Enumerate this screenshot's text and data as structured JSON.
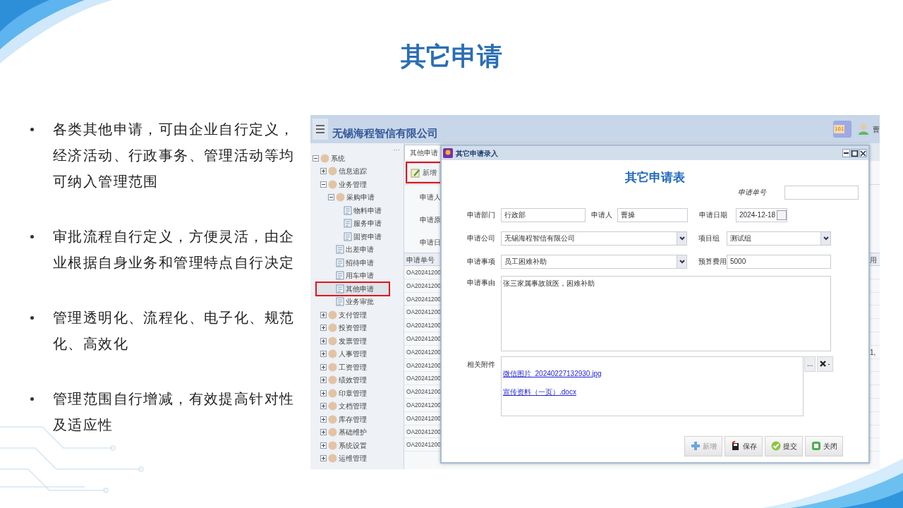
{
  "slide": {
    "title": "其它申请",
    "bullets": [
      "各类其他申请，可由企业自行定义，经济活动、行政事务、管理活动等均可纳入管理范围",
      "审批流程自行定义，方便灵活，由企业根据自身业务和管理特点自行决定",
      "管理透明化、流程化、电子化、规范化、高效化",
      "管理范围自行增减，有效提高针对性及适应性"
    ]
  },
  "app": {
    "company": "无锡海程智信有限公司",
    "notification_count": "161",
    "user": "曹",
    "sidebar": {
      "more": "···",
      "tree": [
        {
          "label": "系统",
          "expanded": true,
          "selected": false,
          "children": [
            {
              "label": "信息追踪",
              "expanded": false,
              "selected": false
            },
            {
              "label": "业务管理",
              "expanded": true,
              "selected": false,
              "children": [
                {
                  "label": "采购申请",
                  "expanded": true,
                  "selected": false,
                  "children": [
                    {
                      "label": "物料申请",
                      "selected": false
                    },
                    {
                      "label": "服务申请",
                      "selected": false
                    },
                    {
                      "label": "固资申请",
                      "selected": false
                    }
                  ]
                },
                {
                  "label": "出差申请",
                  "selected": false
                },
                {
                  "label": "招待申请",
                  "selected": false
                },
                {
                  "label": "用车申请",
                  "selected": false
                },
                {
                  "label": "其他申请",
                  "selected": true
                },
                {
                  "label": "业务审批",
                  "selected": false
                }
              ]
            },
            {
              "label": "支付管理",
              "expanded": false,
              "selected": false
            },
            {
              "label": "投资管理",
              "expanded": false,
              "selected": false
            },
            {
              "label": "发票管理",
              "expanded": false,
              "selected": false
            },
            {
              "label": "人事管理",
              "expanded": false,
              "selected": false
            },
            {
              "label": "工资管理",
              "expanded": false,
              "selected": false
            },
            {
              "label": "绩效管理",
              "expanded": false,
              "selected": false
            },
            {
              "label": "印章管理",
              "expanded": false,
              "selected": false
            },
            {
              "label": "文档管理",
              "expanded": false,
              "selected": false
            },
            {
              "label": "库存管理",
              "expanded": false,
              "selected": false
            },
            {
              "label": "基础维护",
              "expanded": false,
              "selected": false
            },
            {
              "label": "系统设置",
              "expanded": false,
              "selected": false
            },
            {
              "label": "运维管理",
              "expanded": false,
              "selected": false
            }
          ]
        }
      ]
    },
    "tab": {
      "label": "其他申请",
      "selected": true
    },
    "toolbar": [
      {
        "label": "新增",
        "highlighted": true
      }
    ],
    "filters": [
      "申请人",
      "申请原",
      "申请日"
    ],
    "grid": {
      "columns": [
        "申请单号",
        "用"
      ],
      "rows": [
        {
          "number": "OA20241200"
        },
        {
          "number": "OA20241200"
        },
        {
          "number": "OA20241200"
        },
        {
          "number": "OA20241200"
        },
        {
          "number": "OA20241200"
        },
        {
          "number": "OA20241200"
        },
        {
          "number": "OA20241200",
          "fee": "1,"
        },
        {
          "number": "OA20241200"
        },
        {
          "number": "OA20241200"
        },
        {
          "number": "OA20241200"
        },
        {
          "number": "OA20241200"
        },
        {
          "number": "OA20241200"
        },
        {
          "number": "OA20241200"
        },
        {
          "number": "OA20241200"
        }
      ]
    },
    "dialog": {
      "title": "其它申请录入",
      "heading": "其它申请表",
      "number_label": "申请单号",
      "rows": [
        [
          {
            "label": "申请部门",
            "value": "行政部",
            "kind": "text"
          },
          {
            "label": "申请人",
            "value": "曹操",
            "kind": "text"
          },
          {
            "label": "申请日期",
            "value": "2024-12-18",
            "kind": "date"
          }
        ],
        [
          {
            "label": "申请公司",
            "value": "无锡海程智信有限公司",
            "kind": "select"
          },
          {
            "label": "项目组",
            "value": "测试组",
            "kind": "select"
          }
        ],
        [
          {
            "label": "申请事项",
            "value": "员工困难补助",
            "kind": "select"
          },
          {
            "label": "预算费用",
            "value": "5000",
            "kind": "text"
          }
        ]
      ],
      "reason": {
        "label": "申请事由",
        "value": "张三家属事故就医，困难补助"
      },
      "attachments": {
        "label": "相关附件",
        "files": [
          "微信图片_20240227132930.jpg",
          "宣传资料（一页）.docx"
        ],
        "browse": "...",
        "remove": "-"
      },
      "buttons": [
        {
          "label": "新增",
          "kind": "add",
          "disabled": true
        },
        {
          "label": "保存",
          "kind": "save",
          "disabled": false
        },
        {
          "label": "提交",
          "kind": "submit",
          "disabled": false
        },
        {
          "label": "关闭",
          "kind": "close",
          "disabled": false
        }
      ]
    }
  }
}
